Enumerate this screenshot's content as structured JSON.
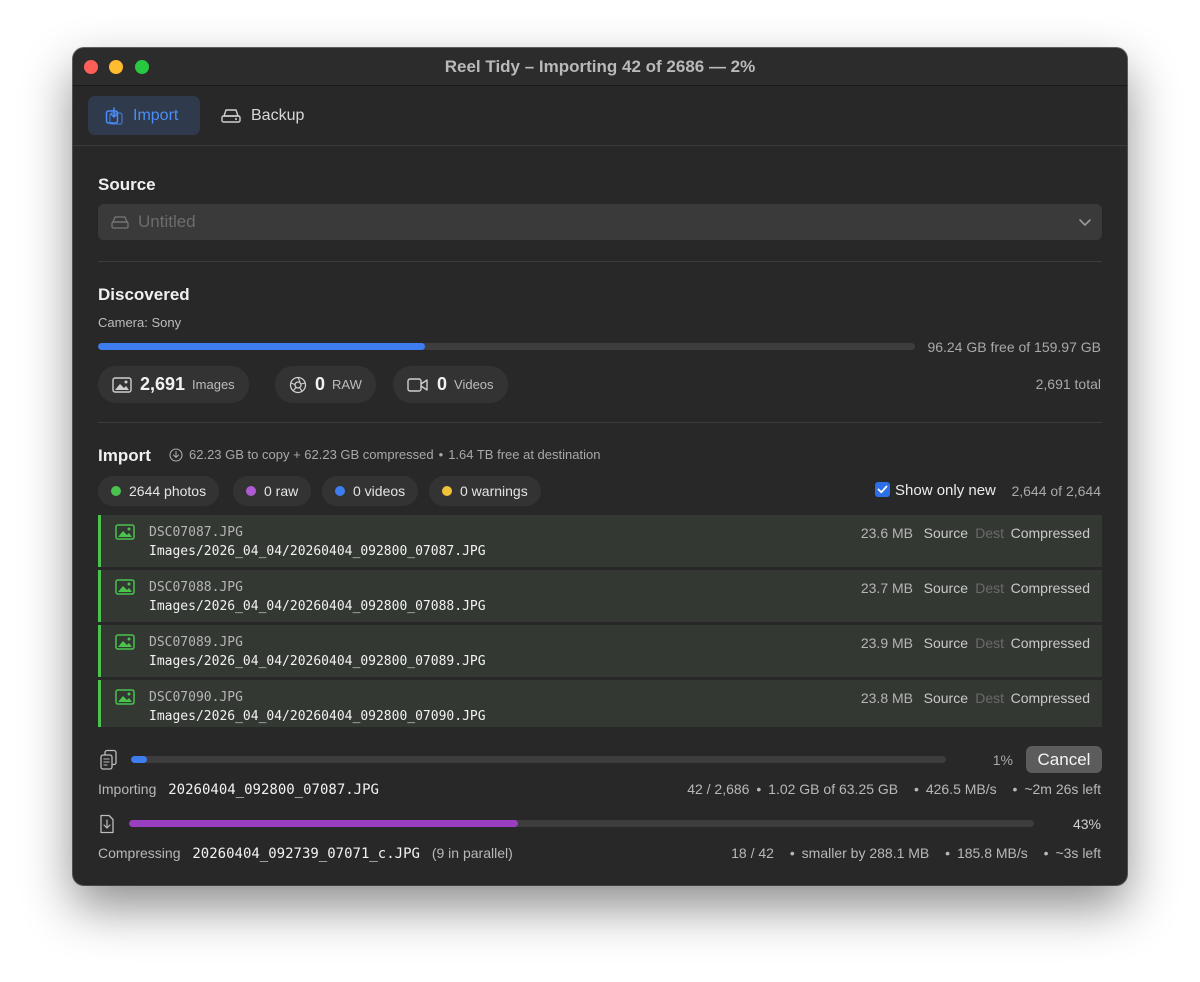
{
  "window": {
    "title": "Reel Tidy – Importing 42 of 2686 — 2%"
  },
  "tabs": [
    {
      "label": "Import",
      "icon": "import-icon",
      "active": true
    },
    {
      "label": "Backup",
      "icon": "drive-icon",
      "active": false
    }
  ],
  "source": {
    "heading": "Source",
    "selected": "Untitled"
  },
  "discovered": {
    "heading": "Discovered",
    "camera": "Camera: Sony",
    "storage_used_fraction": 0.4,
    "storage_text": "96.24 GB free of 159.97 GB",
    "counts": [
      {
        "icon": "image-icon",
        "value": "2,691",
        "label": "Images"
      },
      {
        "icon": "aperture-icon",
        "value": "0",
        "label": "RAW"
      },
      {
        "icon": "video-icon",
        "value": "0",
        "label": "Videos"
      }
    ],
    "total": "2,691 total"
  },
  "import": {
    "heading": "Import",
    "summary": "62.23 GB to copy + 62.23 GB compressed",
    "free_at_dest": "1.64 TB free at destination",
    "chips": [
      {
        "label": "2644 photos",
        "color": "#4ac34f"
      },
      {
        "label": "0 raw",
        "color": "#b05ad6"
      },
      {
        "label": "0 videos",
        "color": "#3d7df0"
      },
      {
        "label": "0 warnings",
        "color": "#f2c13a"
      }
    ],
    "show_only_new_label": "Show only new",
    "show_only_new_checked": true,
    "count_shown": "2,644 of 2,644",
    "files": [
      {
        "name": "DSC07087.JPG",
        "path": "Images/2026_04_04/20260404_092800_07087.JPG",
        "size": "23.6 MB",
        "src": "Source",
        "dest": "Dest",
        "comp": "Compressed"
      },
      {
        "name": "DSC07088.JPG",
        "path": "Images/2026_04_04/20260404_092800_07088.JPG",
        "size": "23.7 MB",
        "src": "Source",
        "dest": "Dest",
        "comp": "Compressed"
      },
      {
        "name": "DSC07089.JPG",
        "path": "Images/2026_04_04/20260404_092800_07089.JPG",
        "size": "23.9 MB",
        "src": "Source",
        "dest": "Dest",
        "comp": "Compressed"
      },
      {
        "name": "DSC07090.JPG",
        "path": "Images/2026_04_04/20260404_092800_07090.JPG",
        "size": "23.8 MB",
        "src": "Source",
        "dest": "Dest",
        "comp": "Compressed"
      }
    ]
  },
  "copy_progress": {
    "fraction": 0.01,
    "percent": "1%",
    "cancel_label": "Cancel",
    "label": "Importing",
    "file": "20260404_092800_07087.JPG",
    "counts": "42 / 2,686",
    "bytes": "1.02 GB of 63.25 GB",
    "speed": "426.5 MB/s",
    "eta": "~2m 26s left"
  },
  "compress_progress": {
    "fraction": 0.43,
    "percent": "43%",
    "label": "Compressing",
    "file": "20260404_092739_07071_c.JPG",
    "parallel": "(9 in parallel)",
    "counts": "18 / 42",
    "saved": "smaller by 288.1 MB",
    "speed": "185.8 MB/s",
    "eta": "~3s left"
  },
  "colors": {
    "accent_blue": "#3d7df0",
    "compress_purple": "#9b3fc2",
    "photo_green": "#4ac34f"
  }
}
